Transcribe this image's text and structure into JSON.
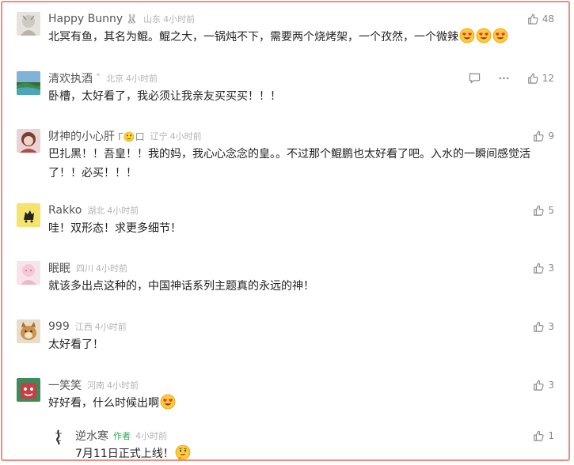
{
  "comments": [
    {
      "user": "Happy Bunny",
      "badge": "🐰",
      "location": "山东",
      "time": "4小时前",
      "likes": "48",
      "text": "北冥有鱼，其名为鲲。鲲之大，一锅炖不下，需要两个烧烤架，一个孜然，一个微辣",
      "emojis": [
        "heart-eyes",
        "heart-eyes",
        "heart-eyes"
      ],
      "avatar_color": "#d9d4cf"
    },
    {
      "user": "清欢执酒",
      "badge": "ˆ",
      "location": "北京",
      "time": "4小时前",
      "likes": "12",
      "text": "卧槽，太好看了，我必须让我亲友买买买！！！",
      "avatar_color": "#3f7c4a"
    },
    {
      "user": "财神的小心肝",
      "badge": "Γ🙂口",
      "location": "辽宁",
      "time": "4小时前",
      "likes": "9",
      "text": "巴扎黑！！吾皇！！我的妈，我心心念念的皇。。不过那个鲲鹏也太好看了吧。入水的一瞬间感觉活了！！必买！！！",
      "avatar_color": "#c9a3a3"
    },
    {
      "user": "Rakko",
      "location": "湖北",
      "time": "4小时前",
      "likes": "5",
      "text": "哇！双形态！求更多细节！",
      "avatar_color": "#f2e26b"
    },
    {
      "user": "眠眠",
      "location": "四川",
      "time": "4小时前",
      "likes": "3",
      "text": "就该多出点这种的，中国神话系列主题真的永远的神！",
      "avatar_color": "#f3d8df"
    },
    {
      "user": "999",
      "location": "江西",
      "time": "4小时前",
      "likes": "3",
      "text": "太好看了！",
      "avatar_color": "#c9a073"
    },
    {
      "user": "一笑笑",
      "location": "河南",
      "time": "4小时前",
      "likes": "3",
      "text": "好好看，什么时候出啊",
      "emojis": [
        "heart-eyes"
      ],
      "avatar_color": "#c83d46"
    }
  ],
  "reply": {
    "user": "逆水寒",
    "author_tag": "作者",
    "time": "4小时前",
    "likes": "1",
    "text": "7月11日正式上线！",
    "emojis": [
      "thinking"
    ]
  },
  "icons": {
    "like": "thumbs-up-icon",
    "reply": "comment-icon",
    "more": "more-icon"
  }
}
